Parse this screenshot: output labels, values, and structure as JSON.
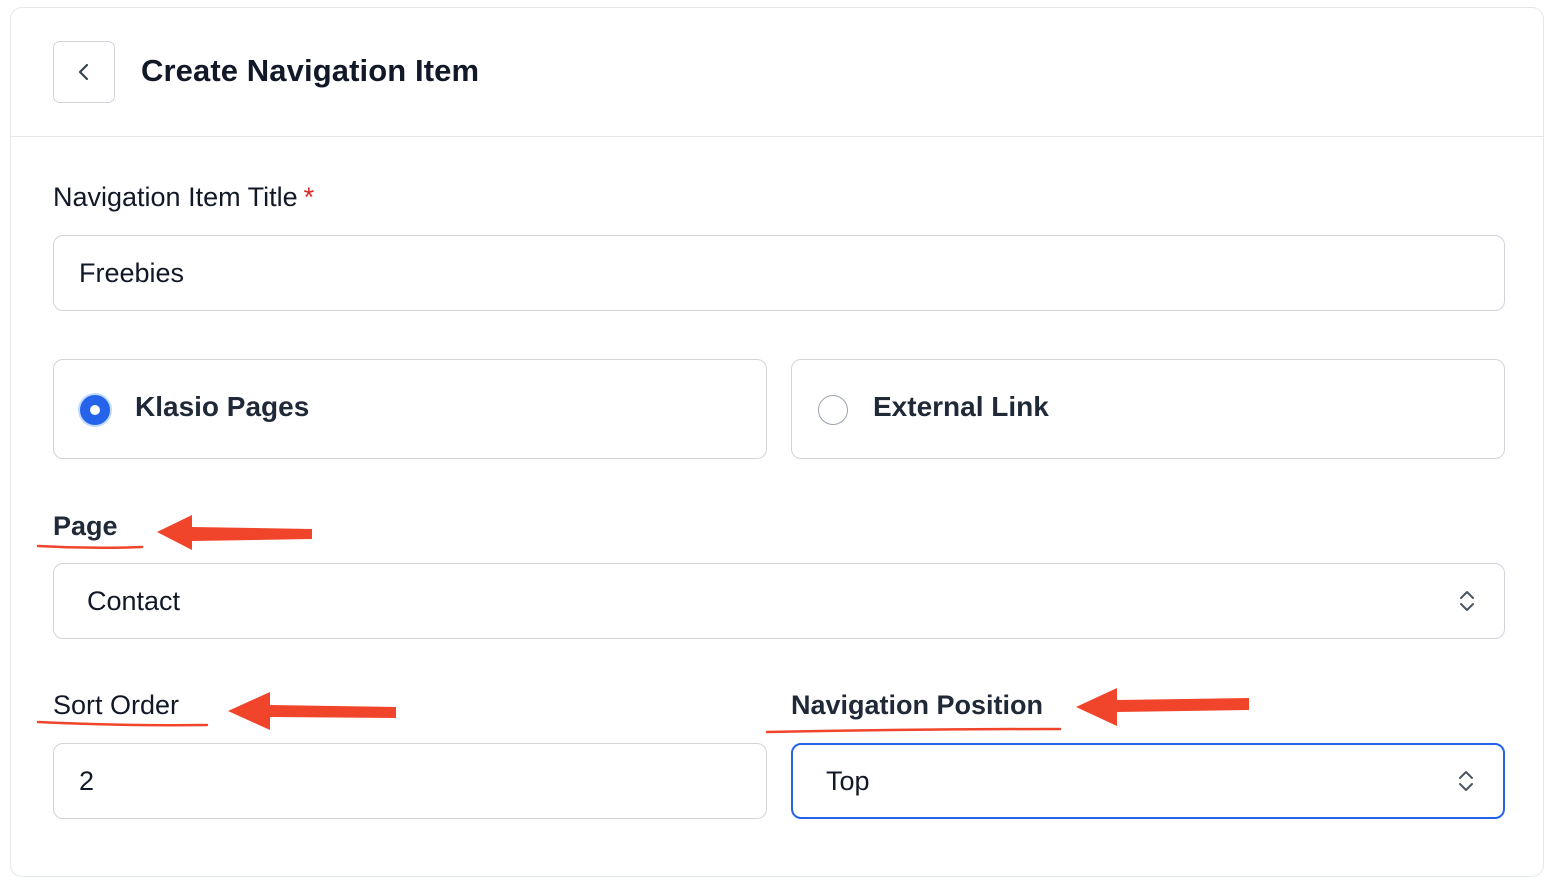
{
  "header": {
    "title": "Create Navigation Item",
    "back_icon": "chevron-left-icon"
  },
  "form": {
    "title_label": "Navigation Item Title",
    "required_mark": "*",
    "title_value": "Freebies",
    "link_type_options": [
      {
        "label": "Klasio Pages",
        "selected": true
      },
      {
        "label": "External Link",
        "selected": false
      }
    ],
    "page_label": "Page",
    "page_value": "Contact",
    "sort_order_label": "Sort Order",
    "sort_order_value": "2",
    "position_label": "Navigation Position",
    "position_value": "Top"
  },
  "annotations": {
    "color": "#f0452a",
    "arrow_targets": [
      "Page",
      "Sort Order",
      "Navigation Position"
    ]
  },
  "colors": {
    "accent": "#2563eb",
    "required": "#dc2626",
    "border": "#d1d5db"
  }
}
